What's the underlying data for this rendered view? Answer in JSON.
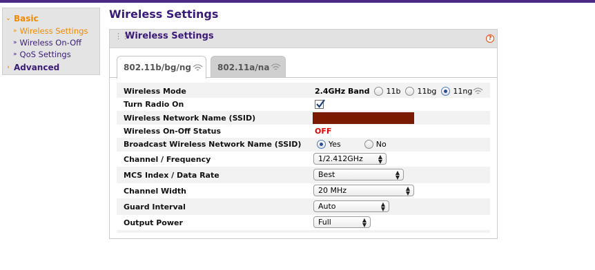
{
  "sidebar": {
    "basic": "Basic",
    "items": [
      {
        "label": "Wireless Settings",
        "active": true
      },
      {
        "label": "Wireless On-Off",
        "active": false
      },
      {
        "label": "QoS Settings",
        "active": false
      }
    ],
    "advanced": "Advanced"
  },
  "page_title": "Wireless Settings",
  "panel": {
    "title": "Wireless Settings",
    "help": "?"
  },
  "tabs": [
    {
      "label": "802.11b/bg/ng",
      "active": true
    },
    {
      "label": "802.11a/na",
      "active": false
    }
  ],
  "form": {
    "wireless_mode": {
      "label": "Wireless Mode",
      "band": "2.4GHz Band",
      "options": [
        "11b",
        "11bg",
        "11ng"
      ],
      "selected": "11ng"
    },
    "turn_radio_on": {
      "label": "Turn Radio On",
      "checked": true
    },
    "ssid": {
      "label": "Wireless Network Name (SSID)",
      "value": ""
    },
    "onoff_status": {
      "label": "Wireless On-Off Status",
      "value": "OFF"
    },
    "broadcast": {
      "label": "Broadcast Wireless Network Name (SSID)",
      "options": [
        "Yes",
        "No"
      ],
      "selected": "Yes"
    },
    "channel": {
      "label": "Channel / Frequency",
      "value": "1/2.412GHz"
    },
    "mcs": {
      "label": "MCS Index / Data Rate",
      "value": "Best"
    },
    "channel_width": {
      "label": "Channel Width",
      "value": "20 MHz"
    },
    "guard_interval": {
      "label": "Guard Interval",
      "value": "Auto"
    },
    "output_power": {
      "label": "Output Power",
      "value": "Full"
    }
  },
  "colors": {
    "brand_purple": "#3a1a78",
    "accent_orange": "#f08a00",
    "status_off": "#e00000",
    "ssid_redacted": "#7a1a00"
  }
}
